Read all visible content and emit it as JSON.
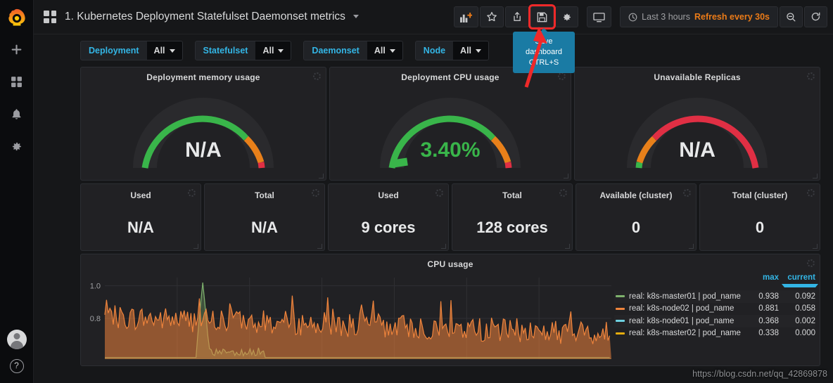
{
  "sidebar": {
    "logo_name": "grafana-logo",
    "items": [
      {
        "icon": "plus-icon",
        "label": "Create"
      },
      {
        "icon": "dashboards-icon",
        "label": "Dashboards"
      },
      {
        "icon": "bell-icon",
        "label": "Alerting"
      },
      {
        "icon": "gear-icon",
        "label": "Configuration"
      }
    ],
    "avatar_label": "User",
    "help_label": "?"
  },
  "header": {
    "dashboard_icon": "dashboards-grid-icon",
    "title": "1. Kubernetes Deployment Statefulset Daemonset metrics",
    "toolbar": [
      {
        "name": "add-panel-button",
        "icon": "add-panel-icon"
      },
      {
        "name": "star-button",
        "icon": "star-icon"
      },
      {
        "name": "share-button",
        "icon": "share-icon"
      },
      {
        "name": "save-button",
        "icon": "save-icon"
      },
      {
        "name": "settings-button",
        "icon": "gear-icon"
      },
      {
        "name": "kiosk-button",
        "icon": "tv-icon"
      }
    ],
    "time_range": "Last 3 hours",
    "refresh_interval": "Refresh every 30s",
    "zoom_out_icon": "zoom-out-icon",
    "refresh_icon": "refresh-icon"
  },
  "tooltip": {
    "line1": "Save dashboard",
    "line2": "CTRL+S"
  },
  "variables": [
    {
      "label": "Deployment",
      "value": "All"
    },
    {
      "label": "Statefulset",
      "value": "All"
    },
    {
      "label": "Daemonset",
      "value": "All"
    },
    {
      "label": "Node",
      "value": "All"
    }
  ],
  "gauges": [
    {
      "title": "Deployment memory usage",
      "value": "N/A",
      "state": "na",
      "reverse": false
    },
    {
      "title": "Deployment CPU usage",
      "value": "3.40%",
      "state": "ok",
      "reverse": false
    },
    {
      "title": "Unavailable Replicas",
      "value": "N/A",
      "state": "na",
      "reverse": true
    }
  ],
  "stats": [
    {
      "title": "Used",
      "value": "N/A"
    },
    {
      "title": "Total",
      "value": "N/A"
    },
    {
      "title": "Used",
      "value": "9 cores"
    },
    {
      "title": "Total",
      "value": "128 cores"
    },
    {
      "title": "Available (cluster)",
      "value": "0"
    },
    {
      "title": "Total (cluster)",
      "value": "0"
    }
  ],
  "graph": {
    "title": "CPU usage"
  },
  "chart_data": {
    "type": "line",
    "title": "CPU usage",
    "xlabel": "",
    "ylabel": "",
    "ylim": [
      0.55,
      1.05
    ],
    "yticks": [
      1.0,
      0.8
    ],
    "grid": true,
    "legend_position": "right",
    "legend_columns": [
      "max",
      "current"
    ],
    "sort_column": "current",
    "series": [
      {
        "name": "real: k8s-master01 | pod_name",
        "color": "#7eb26d",
        "max": 0.938,
        "current": 0.092
      },
      {
        "name": "real: k8s-node02 | pod_name",
        "color": "#ef843c",
        "max": 0.881,
        "current": 0.058
      },
      {
        "name": "real: k8s-node01 | pod_name",
        "color": "#6ed0e0",
        "max": 0.368,
        "current": 0.002
      },
      {
        "name": "real: k8s-master02 | pod_name",
        "color": "#e5ac0e",
        "max": 0.338,
        "current": 0.0
      }
    ]
  },
  "watermark": "https://blog.csdn.net/qq_42869878",
  "colors": {
    "accent_orange": "#eb7b18",
    "link_blue": "#33b5e5",
    "gauge_green": "#39b54a",
    "gauge_orange": "#e88014",
    "gauge_red": "#e02f44",
    "annotation_red": "#ef2929",
    "tooltip_blue": "#1a7ba4"
  }
}
